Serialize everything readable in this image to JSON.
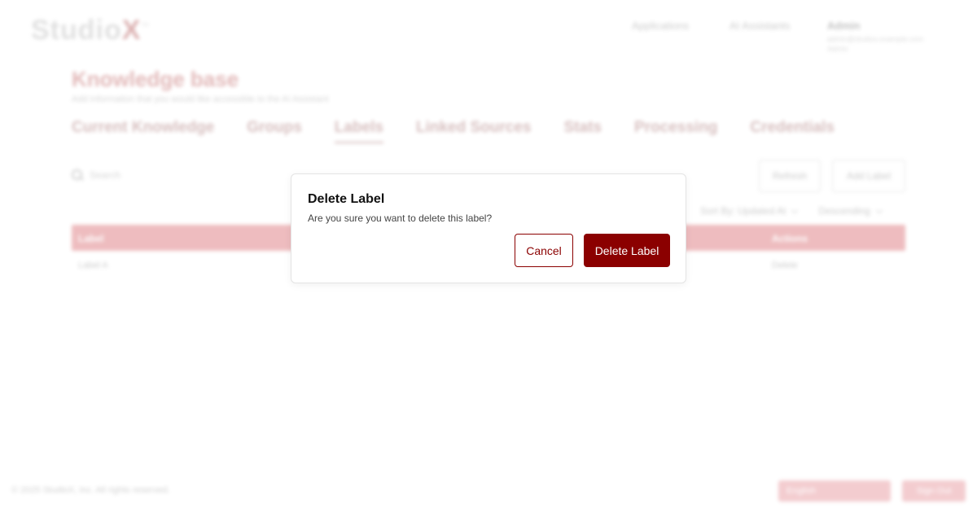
{
  "header": {
    "logo_text": "Studio",
    "logo_x": "X",
    "logo_tm": "™",
    "nav": {
      "applications": "Applications",
      "ai_assistants": "AI Assistants"
    },
    "user": {
      "name": "Admin",
      "email": "admin@studiox.example.com Admin"
    }
  },
  "page": {
    "title": "Knowledge base",
    "subtitle": "Add information that you would like accessible to the AI Assistant"
  },
  "tabs": [
    {
      "label": "Current Knowledge"
    },
    {
      "label": "Groups"
    },
    {
      "label": "Labels"
    },
    {
      "label": "Linked Sources"
    },
    {
      "label": "Stats"
    },
    {
      "label": "Processing"
    },
    {
      "label": "Credentials"
    }
  ],
  "toolbar": {
    "search_placeholder": "Search",
    "refresh_label": "Refresh",
    "add_label": "Add Label"
  },
  "sort": {
    "by_label": "Sort By: Updated At",
    "order_label": "Descending"
  },
  "table": {
    "columns": {
      "label": "Label",
      "actions": "Actions"
    },
    "rows": [
      {
        "label": "Label A",
        "action": "Delete"
      }
    ]
  },
  "footer": {
    "copyright": "© 2025 StudioX, Inc. All rights reserved.",
    "language": "English",
    "sign_out": "Sign Out"
  },
  "modal": {
    "title": "Delete Label",
    "message": "Are you sure you want to delete this label?",
    "cancel_label": "Cancel",
    "confirm_label": "Delete Label"
  },
  "colors": {
    "brand": "#8b0000",
    "table_header": "#c8262e",
    "footer_button": "#d95a64"
  }
}
